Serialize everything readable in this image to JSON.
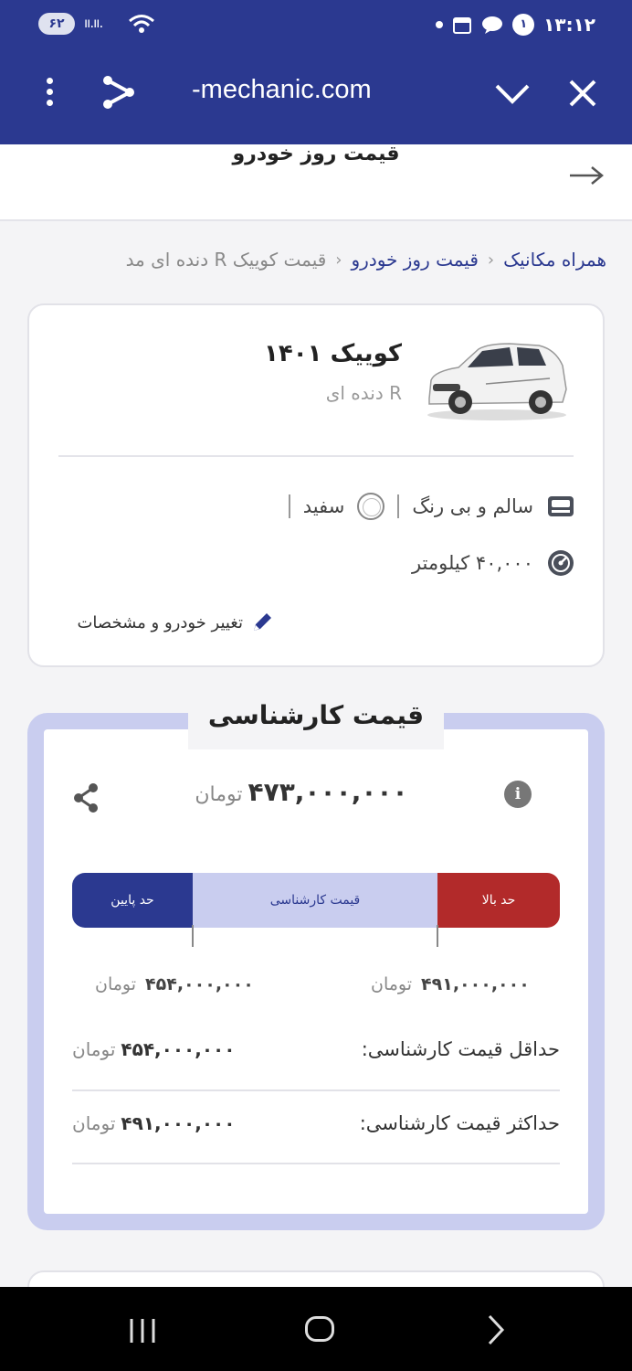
{
  "status": {
    "battery": "۶۲",
    "signal": "ıı.ıı.",
    "notification_count": "۱",
    "time": "۱۳:۱۲"
  },
  "browser": {
    "url": "-mechanic.com",
    "menu_icon": "kebab-icon",
    "share_icon": "share-icon",
    "collapse_icon": "chevron-down-icon",
    "close_icon": "close-icon"
  },
  "header": {
    "title": "قیمت روز خودرو",
    "forward_icon": "arrow-right-icon"
  },
  "breadcrumb": {
    "items": [
      "همراه مکانیک",
      "قیمت روز خودرو",
      "قیمت کوییک R دنده ای مد"
    ],
    "separator": "‹"
  },
  "car": {
    "name": "کوییک ۱۴۰۱",
    "variant": "R دنده ای",
    "condition": "سالم و بی رنگ",
    "color": "سفید",
    "mileage": "۴۰,۰۰۰ کیلومتر",
    "edit_label": "تغییر خودرو و مشخصات"
  },
  "price": {
    "title": "قیمت کارشناسی",
    "info_icon": "i",
    "value": "۴۷۳,۰۰۰,۰۰۰",
    "unit": "تومان",
    "range": {
      "low_label": "حد پایین",
      "mid_label": "قیمت کارشناسی",
      "high_label": "حد بالا",
      "low_value": "۴۵۴,۰۰۰,۰۰۰",
      "high_value": "۴۹۱,۰۰۰,۰۰۰",
      "low_color": "#2b3990",
      "mid_color": "#c9cdef",
      "high_color": "#b22a2a"
    },
    "min_label": "حداقل قیمت کارشناسی:",
    "min_value": "۴۵۴,۰۰۰,۰۰۰",
    "max_label": "حداکثر قیمت کارشناسی:",
    "max_value": "۴۹۱,۰۰۰,۰۰۰"
  },
  "theme": {
    "brand": "#2b3990"
  }
}
